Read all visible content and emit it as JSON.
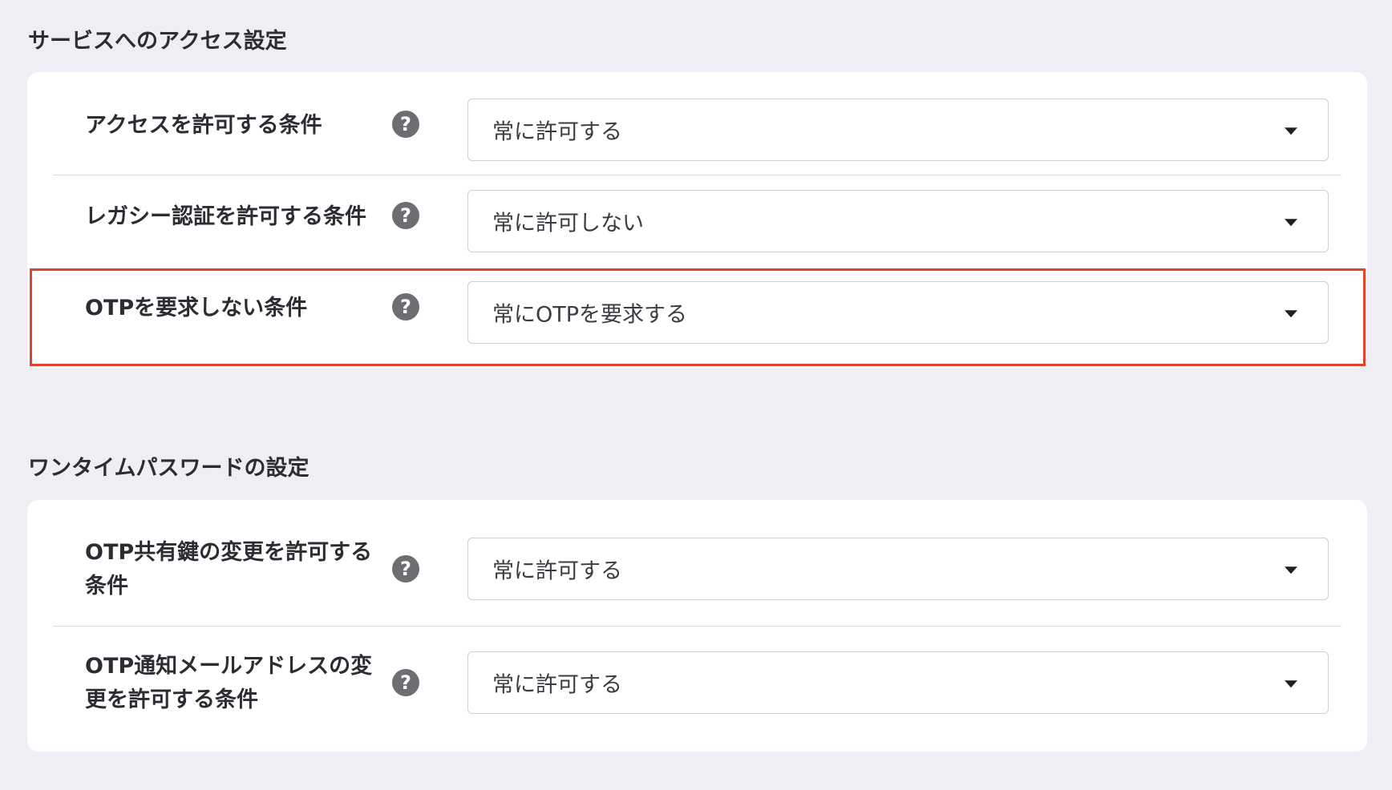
{
  "sections": [
    {
      "title": "サービスへのアクセス設定",
      "rows": [
        {
          "label": "アクセスを許可する条件",
          "value": "常に許可する"
        },
        {
          "label": "レガシー認証を許可する条件",
          "value": "常に許可しない"
        },
        {
          "label": "OTPを要求しない条件",
          "value": "常にOTPを要求する"
        }
      ]
    },
    {
      "title": "ワンタイムパスワードの設定",
      "rows": [
        {
          "label": "OTP共有鍵の変更を許可する条件",
          "value": "常に許可する"
        },
        {
          "label": "OTP通知メールアドレスの変更を許可する条件",
          "value": "常に許可する"
        }
      ]
    }
  ],
  "icons": {
    "help": "question-circle-icon",
    "dropdown": "caret-down-icon"
  },
  "colors": {
    "page_background": "#efeef4",
    "card_background": "#ffffff",
    "help_icon": "#6d6d72",
    "highlight": "#e2412a"
  },
  "help_glyph": "?"
}
